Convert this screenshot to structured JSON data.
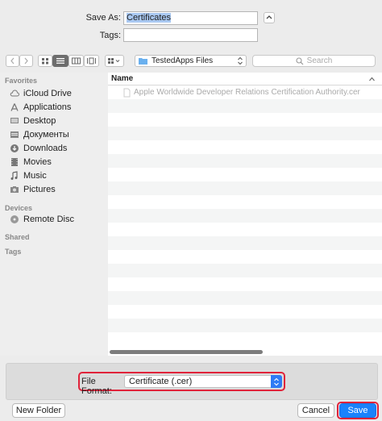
{
  "save_as": {
    "label": "Save As:",
    "value": "Certificates"
  },
  "tags": {
    "label": "Tags:",
    "value": ""
  },
  "toolbar": {
    "location": "TestedApps Files",
    "search_placeholder": "Search"
  },
  "sidebar": {
    "sections": [
      {
        "title": "Favorites",
        "items": [
          {
            "label": "iCloud Drive",
            "icon": "cloud-icon"
          },
          {
            "label": "Applications",
            "icon": "applications-icon"
          },
          {
            "label": "Desktop",
            "icon": "desktop-icon"
          },
          {
            "label": "Документы",
            "icon": "documents-icon"
          },
          {
            "label": "Downloads",
            "icon": "downloads-icon"
          },
          {
            "label": "Movies",
            "icon": "movies-icon"
          },
          {
            "label": "Music",
            "icon": "music-icon"
          },
          {
            "label": "Pictures",
            "icon": "pictures-icon"
          }
        ]
      },
      {
        "title": "Devices",
        "items": [
          {
            "label": "Remote Disc",
            "icon": "disc-icon"
          }
        ]
      },
      {
        "title": "Shared",
        "items": []
      },
      {
        "title": "Tags",
        "items": []
      }
    ]
  },
  "file_list": {
    "column_name": "Name",
    "files": [
      "Apple Worldwide Developer Relations Certification Authority.cer"
    ]
  },
  "format": {
    "label": "File Format:",
    "value": "Certificate (.cer)"
  },
  "buttons": {
    "new_folder": "New Folder",
    "cancel": "Cancel",
    "save": "Save"
  },
  "colors": {
    "accent": "#1a82fb",
    "highlight_box": "#e0233a",
    "selection": "#a9c8f1"
  }
}
